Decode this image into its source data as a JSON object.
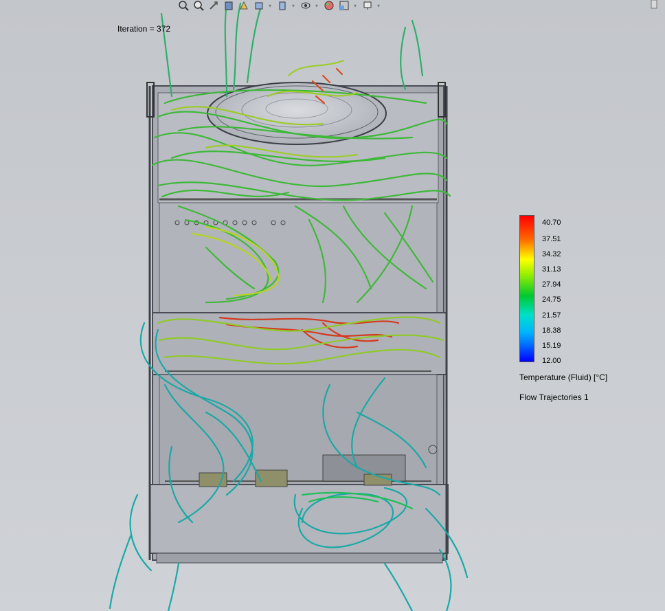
{
  "toolbar": {
    "icons": [
      "zoom-to-fit-icon",
      "zoom-area-icon",
      "previous-view-icon",
      "section-view-icon",
      "dynamic-annotation-icon",
      "view-orientation-icon",
      "display-style-icon",
      "hide-show-icon",
      "edit-appearance-icon",
      "apply-scene-icon",
      "view-settings-icon"
    ]
  },
  "status": {
    "iteration": "Iteration = 372"
  },
  "legend": {
    "ticks": [
      "40.70",
      "37.51",
      "34.32",
      "31.13",
      "27.94",
      "24.75",
      "21.57",
      "18.38",
      "15.19",
      "12.00"
    ],
    "title": "Temperature (Fluid) [°C]",
    "trajectories": "Flow Trajectories 1",
    "colors": [
      "#ff0000",
      "#ff6600",
      "#ffff00",
      "#9bef00",
      "#00c830",
      "#00e0c8",
      "#00b4ff",
      "#0060ff",
      "#0000ff"
    ]
  }
}
